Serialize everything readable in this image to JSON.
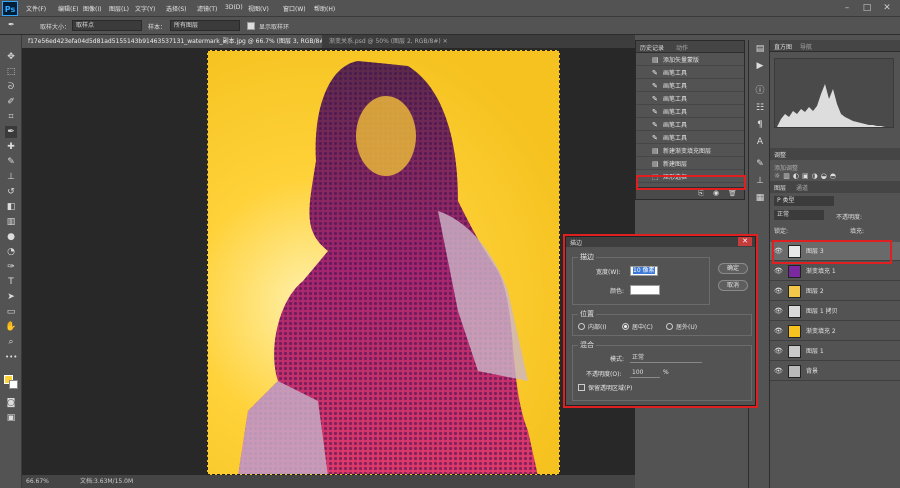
{
  "menubar": {
    "logo": "Ps",
    "items": [
      "文件(F)",
      "编辑(E)",
      "图像(I)",
      "图层(L)",
      "文字(Y)",
      "选择(S)",
      "滤镜(T)",
      "3D(D)",
      "视图(V)",
      "窗口(W)",
      "帮助(H)"
    ],
    "win_min": "–",
    "win_max": "□",
    "win_close": "✕"
  },
  "options": {
    "sample_size_label": "取样大小：",
    "sample_size_value": "取样点",
    "sample_label": "样本：",
    "sample_value": "所有图层",
    "show_ring_label": "显示取样环"
  },
  "tabs": [
    {
      "label": "f17e56ed423efa04d5d81ad5155143b91463537131_watermark_副本.jpg @ 66.7% (图层 3, RGB/8#) * ✕"
    },
    {
      "label": "渐变关系.psd @ 50% (图层 2, RGB/8#) ✕"
    }
  ],
  "status": {
    "zoom": "66.67%",
    "doc": "文档:3.63M/15.0M"
  },
  "history": {
    "tab1": "历史记录",
    "tab2": "动作",
    "rows": [
      {
        "icon": "▤",
        "label": "添加矢量蒙版"
      },
      {
        "icon": "✎",
        "label": "画笔工具"
      },
      {
        "icon": "✎",
        "label": "画笔工具"
      },
      {
        "icon": "✎",
        "label": "画笔工具"
      },
      {
        "icon": "✎",
        "label": "画笔工具"
      },
      {
        "icon": "✎",
        "label": "画笔工具"
      },
      {
        "icon": "✎",
        "label": "画笔工具"
      },
      {
        "icon": "▤",
        "label": "新建渐变填充图层"
      },
      {
        "icon": "▤",
        "label": "新建图层"
      },
      {
        "icon": "⬚",
        "label": "矩形选框"
      }
    ]
  },
  "right": {
    "nav_tab1": "直方图",
    "nav_tab2": "导航",
    "adj_tab": "调整",
    "adj_add_label": "添加调整",
    "layers_tab1": "图层",
    "layers_tab2": "通道",
    "kind_label": "P 类型",
    "blend": "正常",
    "opacity_label": "不透明度:",
    "lock_label": "锁定:",
    "fill_label": "填充:",
    "layers": [
      {
        "name": "图层 3",
        "thumb": "#e8e8e8",
        "selected": true
      },
      {
        "name": "渐变填充 1",
        "thumb": "#7a2a9e"
      },
      {
        "name": "图层 2",
        "thumb": "#f3c84a"
      },
      {
        "name": "图层 1 拷贝",
        "thumb": "#d8d8d8"
      },
      {
        "name": "渐变填充 2",
        "thumb": "#f5c21f"
      },
      {
        "name": "图层 1",
        "thumb": "#c9c9c9"
      },
      {
        "name": "背景",
        "thumb": "#b9b9b9"
      }
    ]
  },
  "dialog": {
    "title": "描边",
    "stroke_group": "描边",
    "width_label": "宽度(W):",
    "width_value": "10 像素",
    "color_label": "颜色:",
    "ok": "确定",
    "cancel": "取消",
    "position_group": "位置",
    "pos_inside": "内部(I)",
    "pos_center": "居中(C)",
    "pos_outside": "居外(U)",
    "blend_group": "混合",
    "mode_label": "模式:",
    "mode_value": "正常",
    "opacity_label": "不透明度(O):",
    "opacity_value": "100",
    "opacity_unit": "%",
    "preserve_label": "保留透明区域(P)"
  }
}
